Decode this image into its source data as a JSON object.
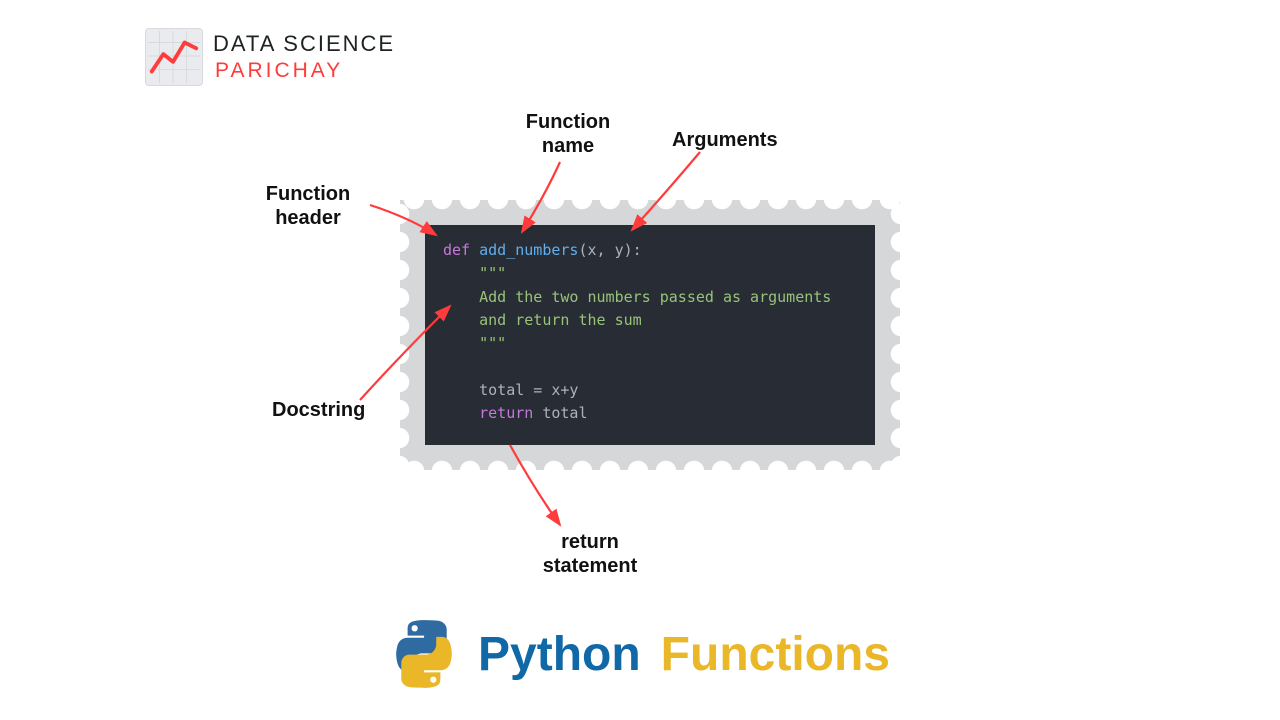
{
  "logo": {
    "line1": "DATA SCIENCE",
    "line2": "PARICHAY"
  },
  "labels": {
    "function_name": "Function\nname",
    "arguments": "Arguments",
    "function_header": "Function\nheader",
    "docstring": "Docstring",
    "return_statement": "return\nstatement"
  },
  "code": {
    "def": "def",
    "space1": " ",
    "func_name": "add_numbers",
    "params": "(x, y):",
    "indent": "    ",
    "triple_quote": "\"\"\"",
    "doc_line1": "Add the two numbers passed as arguments",
    "doc_line2": "and return the sum",
    "blank": "",
    "assign": "total = x+y",
    "return_kw": "return",
    "return_var": " total"
  },
  "title": {
    "word1": "Python",
    "word2": "Functions"
  }
}
